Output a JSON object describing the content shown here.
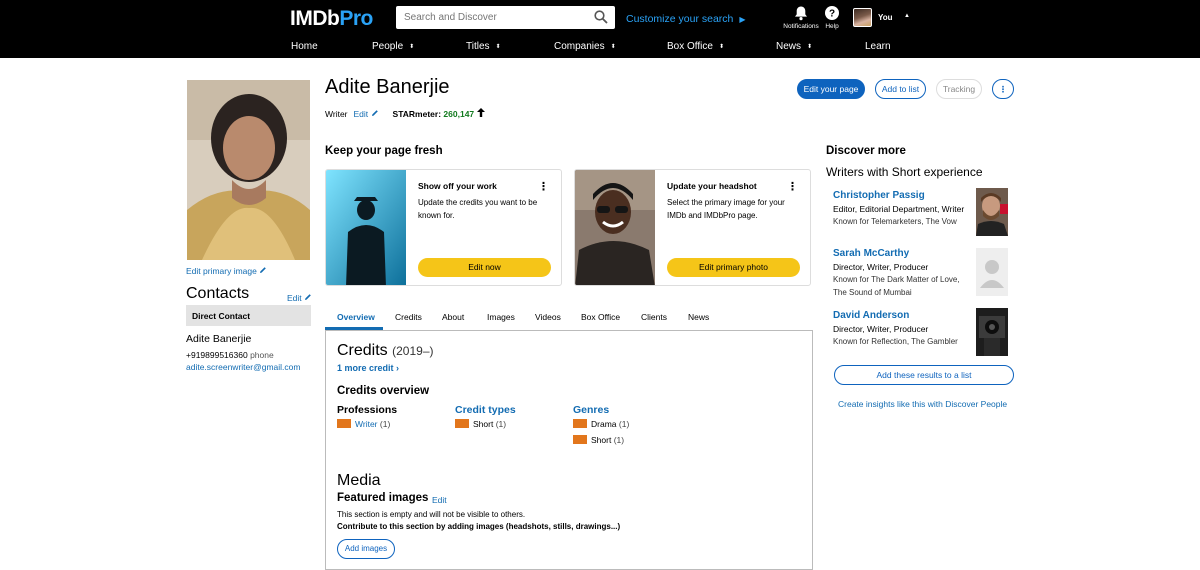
{
  "topbar": {
    "logo_main": "IMDb",
    "logo_pro": "Pro",
    "search_placeholder": "Search and Discover",
    "customize_label": "Customize your search",
    "notifications_label": "Notifications",
    "help_label": "Help",
    "user_label": "You",
    "nav": [
      {
        "label": "Home",
        "caret": false
      },
      {
        "label": "People",
        "caret": true
      },
      {
        "label": "Titles",
        "caret": true
      },
      {
        "label": "Companies",
        "caret": true
      },
      {
        "label": "Box Office",
        "caret": true
      },
      {
        "label": "News",
        "caret": true
      },
      {
        "label": "Learn",
        "caret": false
      }
    ]
  },
  "profile": {
    "name": "Adite Banerjie",
    "role": "Writer",
    "edit_label": "Edit",
    "starmeter_label": "STARmeter:",
    "starmeter_value": "260,147",
    "edit_primary_image": "Edit primary image",
    "actions": {
      "edit_page": "Edit your page",
      "add_to_list": "Add to list",
      "tracking": "Tracking",
      "more": "⋮"
    }
  },
  "contacts": {
    "title": "Contacts",
    "edit_label": "Edit",
    "section": "Direct Contact",
    "name": "Adite Banerjie",
    "phone": "+919899516360",
    "phone_type": "phone",
    "email": "adite.screenwriter@gmail.com"
  },
  "fresh": {
    "title": "Keep your page fresh",
    "cards": [
      {
        "title": "Show off your work",
        "desc": "Update the credits you want to be known for.",
        "button": "Edit now"
      },
      {
        "title": "Update your headshot",
        "desc": "Select the primary image for your IMDb and IMDbPro page.",
        "button": "Edit primary photo"
      }
    ]
  },
  "tabs": [
    "Overview",
    "Credits",
    "About",
    "Images",
    "Videos",
    "Box Office",
    "Clients",
    "News"
  ],
  "credits": {
    "title": "Credits",
    "years": "(2019–)",
    "more_credit": "1 more credit ›",
    "overview_title": "Credits overview",
    "professions_label": "Professions",
    "credit_types_label": "Credit types",
    "genres_label": "Genres",
    "professions": [
      {
        "label": "Writer",
        "count": "(1)"
      }
    ],
    "credit_types": [
      {
        "label": "Short",
        "count": "(1)"
      }
    ],
    "genres": [
      {
        "label": "Drama",
        "count": "(1)"
      },
      {
        "label": "Short",
        "count": "(1)"
      }
    ]
  },
  "media": {
    "title": "Media",
    "featured_label": "Featured images",
    "edit_label": "Edit",
    "empty_note": "This section is empty and will not be visible to others.",
    "contribute": "Contribute to this section by adding images (headshots, stills, drawings...)",
    "add_images": "Add images"
  },
  "discover": {
    "title": "Discover more",
    "subtitle": "Writers with Short experience",
    "people": [
      {
        "name": "Christopher Passig",
        "role": "Editor, Editorial Department, Writer",
        "known": "Known for Telemarketers, The Vow"
      },
      {
        "name": "Sarah McCarthy",
        "role": "Director, Writer, Producer",
        "known": "Known for The Dark Matter of Love, The Sound of Mumbai"
      },
      {
        "name": "David Anderson",
        "role": "Director, Writer, Producer",
        "known": "Known for Reflection, The Gambler"
      }
    ],
    "add_results": "Add these results to a list",
    "create_insights": "Create insights like this with Discover People"
  },
  "colors": {
    "accent_blue": "#136cb2",
    "primary_button": "#0e63be",
    "imdb_yellow": "#f5c518",
    "bar_orange": "#e2761c",
    "starmeter_green": "#127a1e",
    "topbar": "#000000"
  }
}
